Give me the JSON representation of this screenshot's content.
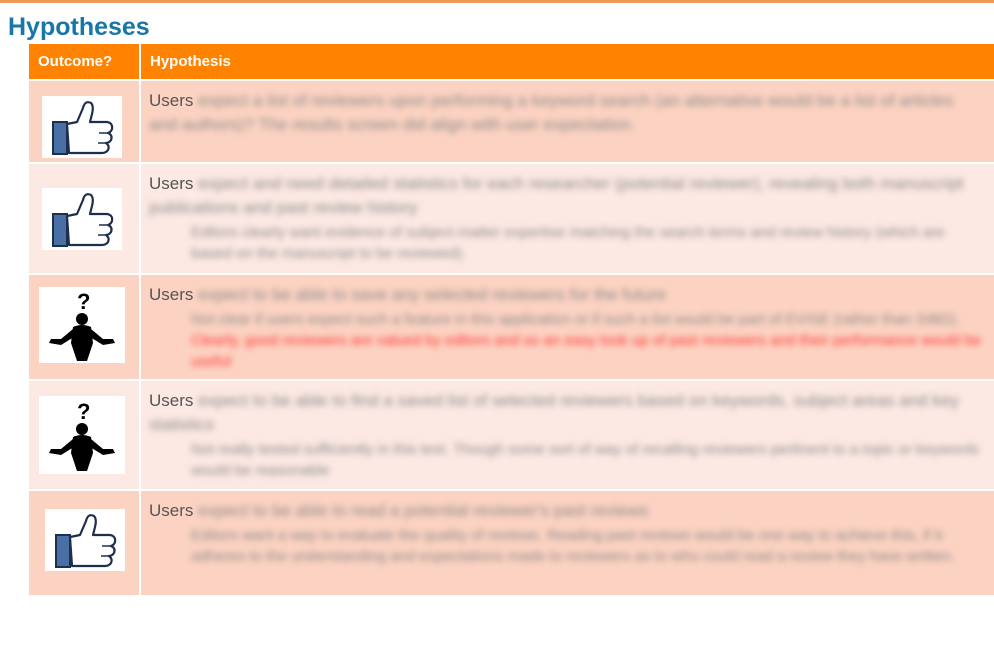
{
  "slide": {
    "title": "Hypotheses"
  },
  "table": {
    "headers": {
      "outcome": "Outcome?",
      "hypothesis": "Hypothesis"
    },
    "rows": [
      {
        "outcome_icon": "thumbs-up-icon",
        "subject": "Users",
        "statement": "expect a list of reviewers upon performing a keyword search (an alternative would be a list of articles and authors)? The results screen did align with user expectation.",
        "note": "",
        "note_highlight": ""
      },
      {
        "outcome_icon": "thumbs-up-icon",
        "subject": "Users",
        "statement": "expect and need detailed statistics for each researcher (potential reviewer), revealing both manuscript publications and past review history",
        "note": "Editors clearly want evidence of subject matter expertise matching the search terms and review history (which are based on the manuscript to be reviewed).",
        "note_highlight": ""
      },
      {
        "outcome_icon": "question-person-icon",
        "subject": "Users",
        "statement": "expect to be able to save any selected reviewers for the future",
        "note": "Not clear if users expect such a feature in this application or if such a list would be part of EVISE (rather than SIBD).",
        "note_highlight": "Clearly, good reviewers are valued by editors and so an easy look up of past reviewers and their performance would be useful"
      },
      {
        "outcome_icon": "question-person-icon",
        "subject": "Users",
        "statement": "expect to be able to find a saved list of selected reviewers based on keywords, subject areas and key statistics",
        "note": "Not really tested sufficiently in this test. Though some sort of way of recalling reviewers pertinent to a topic or keywords would be reasonable",
        "note_highlight": ""
      },
      {
        "outcome_icon": "thumbs-up-icon",
        "subject": "Users",
        "statement": "expect to be able to read a potential reviewer's past reviews",
        "note": "Editors want a way to evaluate the quality of reviews. Reading past reviews would be one way to achieve this, if it adheres to the understanding and expectations made to reviewers as to who could read a review they have written.",
        "note_highlight": ""
      }
    ]
  },
  "colors": {
    "title": "#1777a6",
    "header_bg": "#ff8200",
    "row_odd": "#fcd3c2",
    "row_even": "#fde9e3",
    "highlight": "#ff3030",
    "thumb_blue": "#4a6fa5"
  }
}
